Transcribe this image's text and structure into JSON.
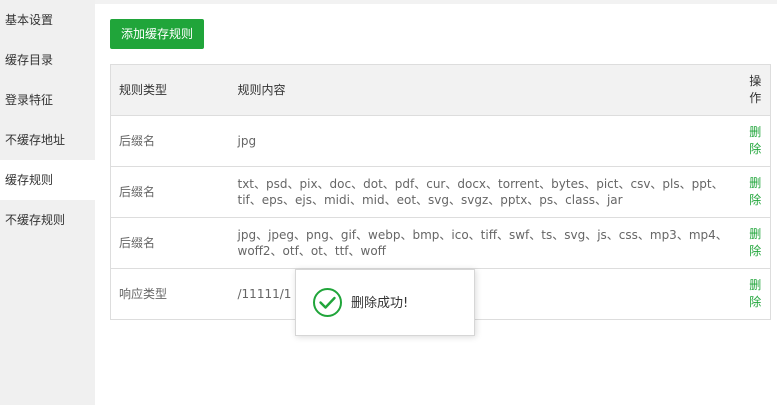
{
  "sidebar": {
    "items": [
      {
        "label": "基本设置"
      },
      {
        "label": "缓存目录"
      },
      {
        "label": "登录特征"
      },
      {
        "label": "不缓存地址"
      },
      {
        "label": "缓存规则"
      },
      {
        "label": "不缓存规则"
      }
    ],
    "active_index": 4
  },
  "toolbar": {
    "add_label": "添加缓存规则"
  },
  "table": {
    "headers": {
      "type": "规则类型",
      "content": "规则内容",
      "op": "操作"
    },
    "rows": [
      {
        "type": "后缀名",
        "content": "jpg",
        "op": "删除"
      },
      {
        "type": "后缀名",
        "content": "txt、psd、pix、doc、dot、pdf、cur、docx、torrent、bytes、pict、csv、pls、ppt、tif、eps、ejs、midi、mid、eot、svg、svgz、pptx、ps、class、jar",
        "op": "删除"
      },
      {
        "type": "后缀名",
        "content": "jpg、jpeg、png、gif、webp、bmp、ico、tiff、swf、ts、svg、js、css、mp3、mp4、woff2、otf、ot、ttf、woff",
        "op": "删除"
      },
      {
        "type": "响应类型",
        "content": "/11111/1",
        "op": "删除"
      }
    ]
  },
  "toast": {
    "message": "删除成功!",
    "icon": "check-circle-icon"
  },
  "colors": {
    "accent": "#20a53a",
    "sidebar_bg": "#f0f0f0",
    "header_bg": "#f2f2f2",
    "border": "#dddddd"
  }
}
